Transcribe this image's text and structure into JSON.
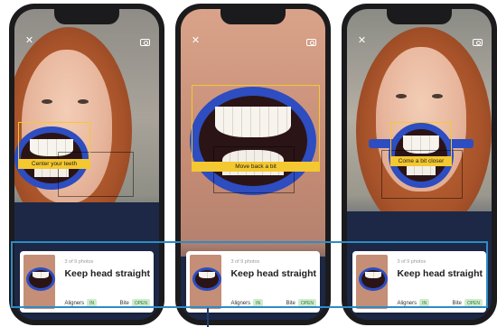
{
  "phones": [
    {
      "guidance": "Center your teeth",
      "card": {
        "count": "3 of 9 photos",
        "title": "Keep head straight",
        "aligners_label": "Aligners",
        "aligners_value": "IN",
        "bite_label": "Bite",
        "bite_value": "OPEN"
      }
    },
    {
      "guidance": "Move back a bit",
      "card": {
        "count": "3 of 9 photos",
        "title": "Keep head straight",
        "aligners_label": "Aligners",
        "aligners_value": "IN",
        "bite_label": "Bite",
        "bite_value": "OPEN"
      }
    },
    {
      "guidance": "Come a bit closer",
      "card": {
        "count": "3 of 9 photos",
        "title": "Keep head straight",
        "aligners_label": "Aligners",
        "aligners_value": "IN",
        "bite_label": "Bite",
        "bite_value": "OPEN"
      }
    }
  ],
  "icons": {
    "close": "close-icon",
    "camera": "camera-switch-icon"
  },
  "colors": {
    "guide": "#f4c830",
    "retractor": "#2d4dc0",
    "highlight": "#2f8bc6",
    "chip_bg": "#cfeccd",
    "chip_text": "#2e7a3a"
  }
}
